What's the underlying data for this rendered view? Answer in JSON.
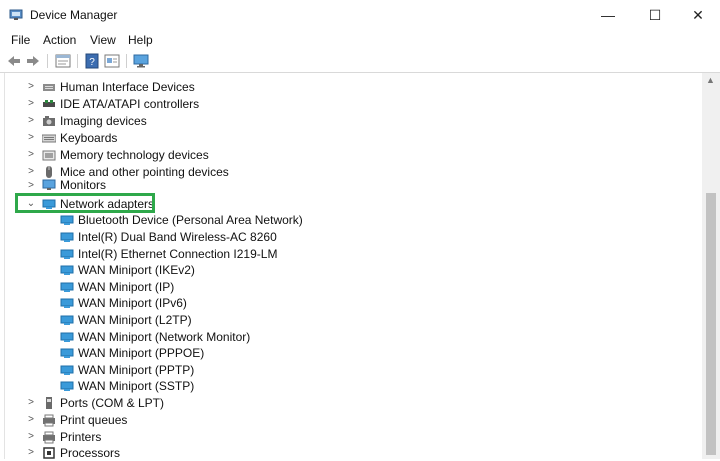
{
  "window": {
    "title": "Device Manager",
    "controls": {
      "minimize": "—",
      "maximize": "☐",
      "close": "✕"
    }
  },
  "menu": [
    "File",
    "Action",
    "View",
    "Help"
  ],
  "toolbar": {
    "buttons": [
      "back-arrow-icon",
      "forward-arrow-icon",
      "properties-icon",
      "help-icon",
      "update-driver-icon",
      "monitor-icon"
    ]
  },
  "tree": {
    "categories": [
      {
        "label": "Human Interface Devices",
        "icon": "hid-icon",
        "expanded": false
      },
      {
        "label": "IDE ATA/ATAPI controllers",
        "icon": "ide-icon",
        "expanded": false
      },
      {
        "label": "Imaging devices",
        "icon": "camera-icon",
        "expanded": false
      },
      {
        "label": "Keyboards",
        "icon": "keyboard-icon",
        "expanded": false
      },
      {
        "label": "Memory technology devices",
        "icon": "memory-icon",
        "expanded": false
      },
      {
        "label": "Mice and other pointing devices",
        "icon": "mouse-icon",
        "expanded": false
      },
      {
        "label": "Monitors",
        "icon": "monitor-icon",
        "expanded": false
      },
      {
        "label": "Network adapters",
        "icon": "network-icon",
        "expanded": true
      },
      {
        "label": "Ports (COM & LPT)",
        "icon": "port-icon",
        "expanded": false
      },
      {
        "label": "Print queues",
        "icon": "printer-icon",
        "expanded": false
      },
      {
        "label": "Printers",
        "icon": "printer-icon",
        "expanded": false
      },
      {
        "label": "Processors",
        "icon": "processor-icon",
        "expanded": false
      }
    ],
    "network_adapters": [
      "Bluetooth Device (Personal Area Network)",
      "Intel(R) Dual Band Wireless-AC 8260",
      "Intel(R) Ethernet Connection I219-LM",
      "WAN Miniport (IKEv2)",
      "WAN Miniport (IP)",
      "WAN Miniport (IPv6)",
      "WAN Miniport (L2TP)",
      "WAN Miniport (Network Monitor)",
      "WAN Miniport (PPPOE)",
      "WAN Miniport (PPTP)",
      "WAN Miniport (SSTP)"
    ]
  },
  "colors": {
    "highlight": "#2ea84a",
    "network_icon": "#3a9ad9",
    "scrollbar_thumb": "#c2c2c2"
  }
}
